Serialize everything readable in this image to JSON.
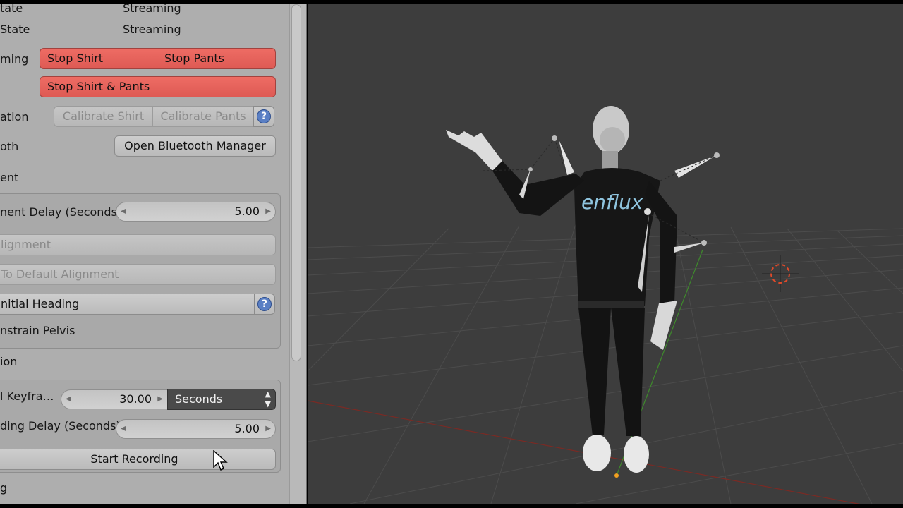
{
  "status": {
    "row1": {
      "label": "tate",
      "value": "Streaming"
    },
    "row2": {
      "label": "State",
      "value": "Streaming"
    }
  },
  "streaming": {
    "label": "ming",
    "stop_shirt": "Stop Shirt",
    "stop_pants": "Stop Pants",
    "stop_both": "Stop Shirt & Pants"
  },
  "calibration": {
    "label": "ation",
    "calibrate_shirt": "Calibrate Shirt",
    "calibrate_pants": "Calibrate Pants",
    "help": "?"
  },
  "bluetooth": {
    "label": "oth",
    "open_manager": "Open Bluetooth Manager"
  },
  "alignment": {
    "section_title": "ent",
    "delay_label": "nent Delay (Seconds)",
    "delay_value": "5.00",
    "alignment_button": "lignment",
    "default_button": "To Default Alignment",
    "heading_button": "nitial Heading",
    "heading_help": "?",
    "constrain": "nstrain Pelvis"
  },
  "recording": {
    "section_title": "ion",
    "keyframe_label": "l Keyfra…",
    "keyframe_value": "30.00",
    "unit": "Seconds",
    "delay_label": "ding Delay (Seconds)",
    "delay_value": "5.00",
    "start_button": "Start Recording",
    "next_section": "g"
  },
  "viewport": {
    "logo_text": "enflux",
    "background": "#3d3d3d",
    "grid_color": "#4c4c4c",
    "x_axis_color": "#7a2a24",
    "y_axis_color": "#3e8a2c",
    "cursor3d_color": "#e04a2a"
  },
  "colors": {
    "panel_bg": "#aeaeae",
    "stop_red": "#e8655e",
    "help_blue": "#5a7fc4"
  }
}
